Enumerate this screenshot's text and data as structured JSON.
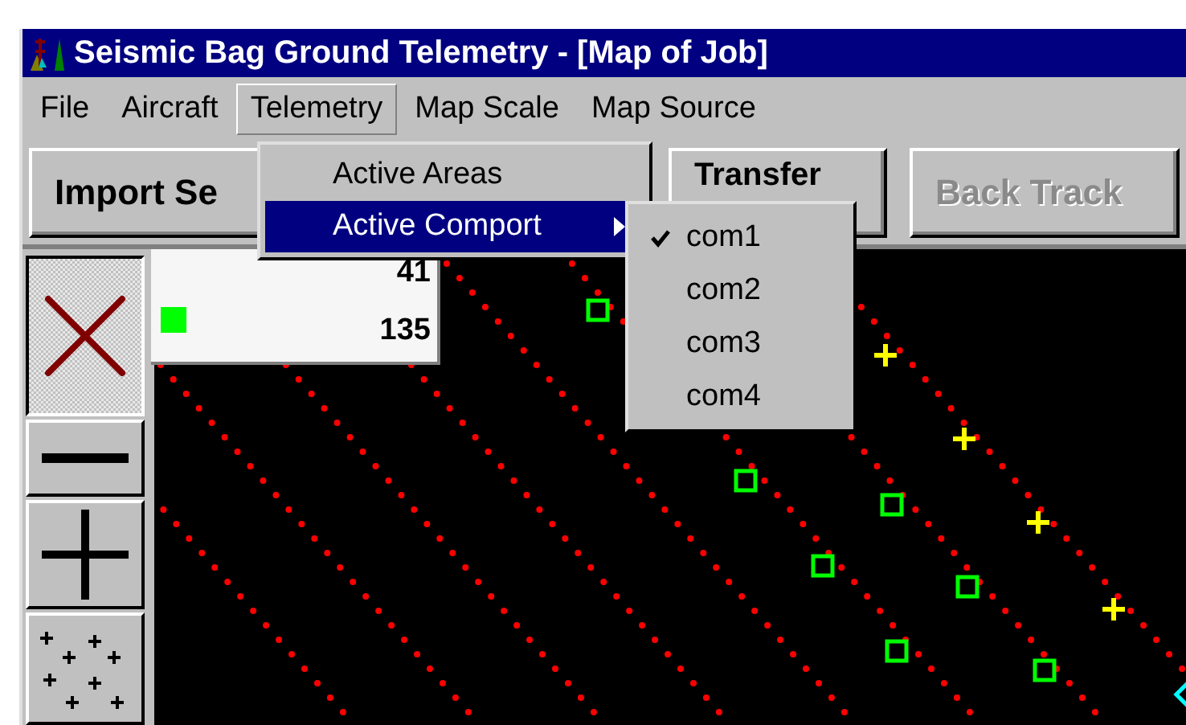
{
  "window": {
    "title": "Seismic Bag Ground Telemetry - [Map of Job]"
  },
  "menu": [
    {
      "label": "File",
      "selected": false
    },
    {
      "label": "Aircraft",
      "selected": false
    },
    {
      "label": "Telemetry",
      "selected": true
    },
    {
      "label": "Map Scale",
      "selected": false
    },
    {
      "label": "Map Source",
      "selected": false
    }
  ],
  "dropdown": [
    {
      "label": "Active Areas",
      "selected": false,
      "submenu": false
    },
    {
      "label": "Active Comport",
      "selected": true,
      "submenu": true
    }
  ],
  "submenu": [
    {
      "label": "com1",
      "checked": true
    },
    {
      "label": "com2",
      "checked": false
    },
    {
      "label": "com3",
      "checked": false
    },
    {
      "label": "com4",
      "checked": false
    }
  ],
  "toolbar": [
    {
      "label": "Import Se",
      "disabled": false
    },
    {
      "label": "Transfer",
      "disabled": false
    },
    {
      "label": "Back Track",
      "disabled": true
    }
  ],
  "tools": [
    {
      "kind": "close",
      "pressed": true
    },
    {
      "kind": "minus",
      "pressed": false
    },
    {
      "kind": "plus",
      "pressed": false
    },
    {
      "kind": "scatter",
      "pressed": false
    }
  ],
  "info": {
    "color": "#00ff00",
    "values": [
      "41",
      "135"
    ]
  }
}
